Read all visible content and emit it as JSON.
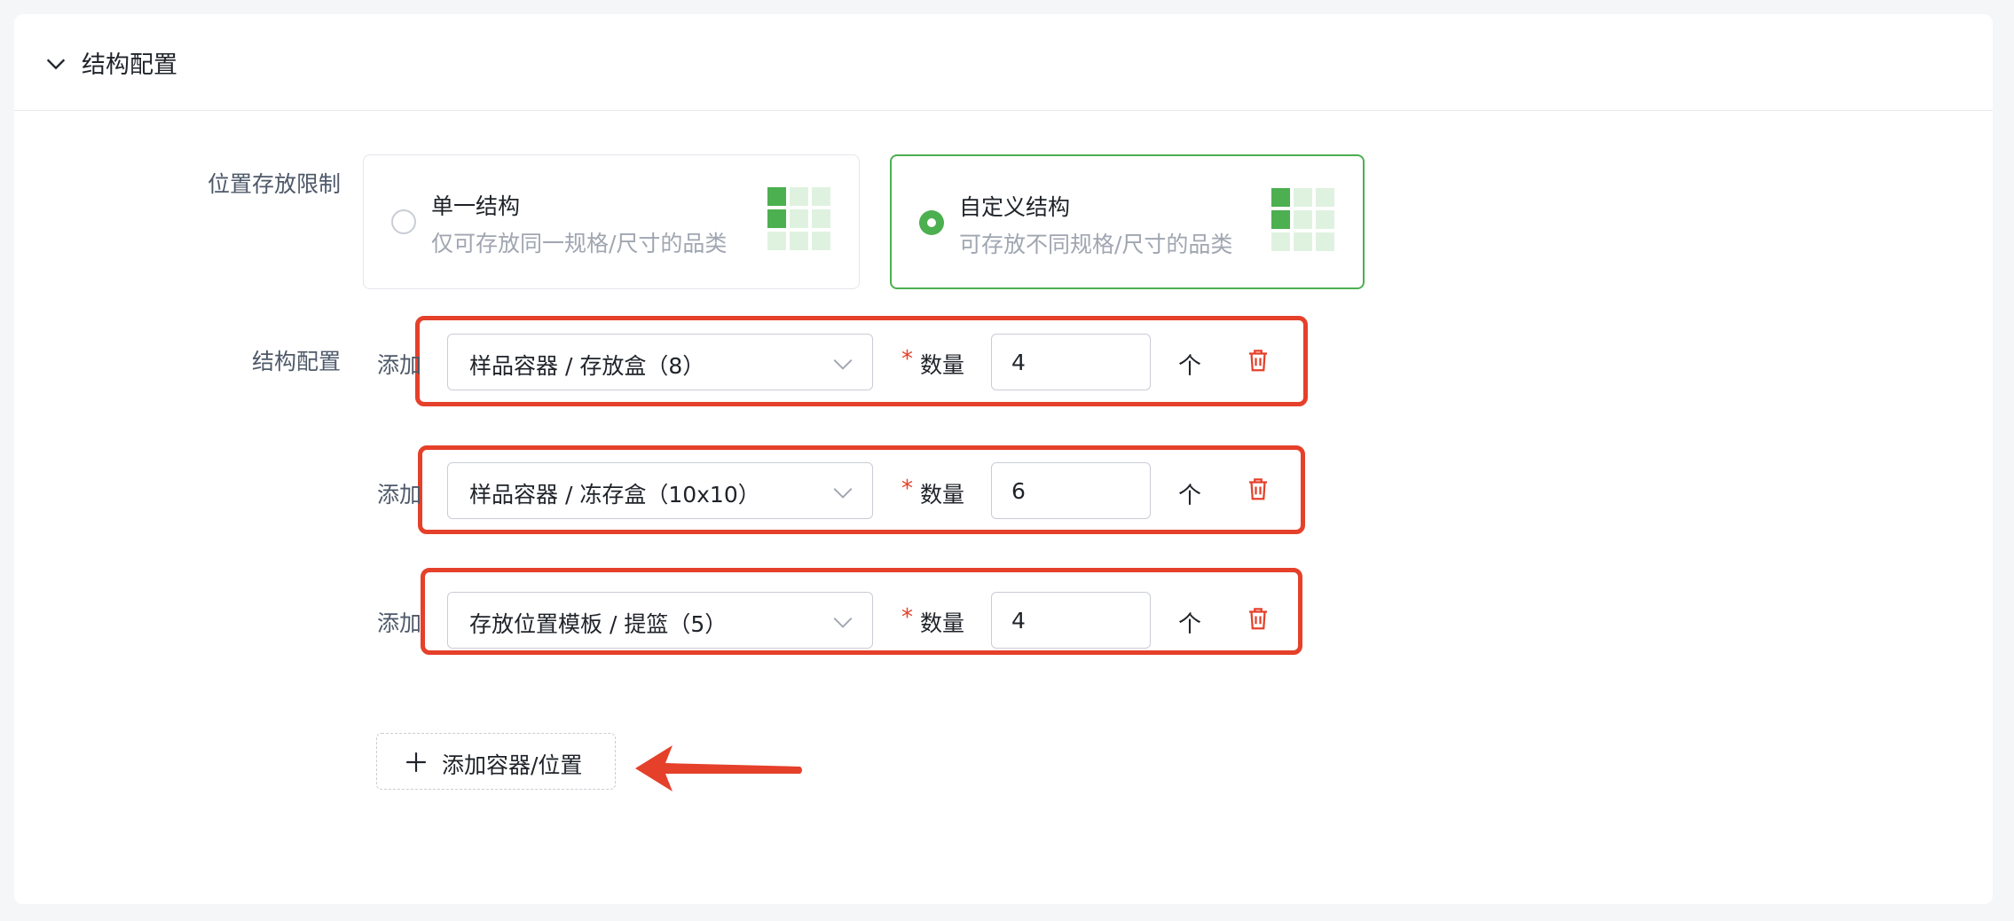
{
  "section": {
    "title": "结构配置"
  },
  "storage_limit": {
    "label": "位置存放限制",
    "options": [
      {
        "title": "单一结构",
        "desc": "仅可存放同一规格/尺寸的品类",
        "selected": false
      },
      {
        "title": "自定义结构",
        "desc": "可存放不同规格/尺寸的品类",
        "selected": true
      }
    ]
  },
  "structure_config": {
    "label": "结构配置",
    "rows": [
      {
        "add_label": "添加",
        "select_value": "样品容器 / 存放盒（8）",
        "qty_label": "数量",
        "qty_value": "4",
        "unit": "个"
      },
      {
        "add_label": "添加",
        "select_value": "样品容器 / 冻存盒（10x10）",
        "qty_label": "数量",
        "qty_value": "6",
        "unit": "个"
      },
      {
        "add_label": "添加",
        "select_value": "存放位置模板 / 提篮（5）",
        "qty_label": "数量",
        "qty_value": "4",
        "unit": "个"
      }
    ],
    "required_mark": "*",
    "add_button": "添加容器/位置"
  },
  "colors": {
    "accent_green": "#4caf50",
    "light_green": "#dff2e0",
    "danger_red": "#e5402a",
    "annotation_red": "#e5402a"
  },
  "icons": {
    "collapse": "chevron-down-icon",
    "grid": "grid-structure-icon",
    "dropdown": "chevron-down-icon",
    "delete": "trash-icon",
    "add": "plus-icon"
  }
}
